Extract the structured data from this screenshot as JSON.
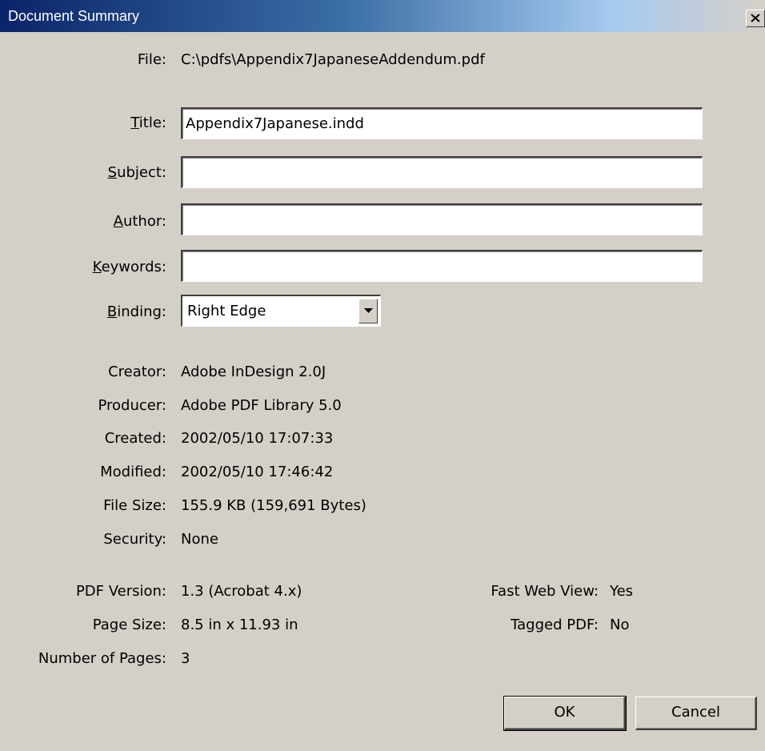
{
  "window": {
    "title": "Document Summary",
    "close_icon": "close-x-icon"
  },
  "file": {
    "label": "File:",
    "value": "C:\\pdfs\\Appendix7JapaneseAddendum.pdf"
  },
  "fields": {
    "title": {
      "label_accel": "T",
      "label_rest": "itle:",
      "value": "Appendix7Japanese.indd"
    },
    "subject": {
      "label_accel": "S",
      "label_rest": "ubject:",
      "value": ""
    },
    "author": {
      "label_accel": "A",
      "label_rest": "uthor:",
      "value": ""
    },
    "keywords": {
      "label_accel": "K",
      "label_rest": "eywords:",
      "value": ""
    }
  },
  "binding": {
    "label_accel": "B",
    "label_rest": "inding:",
    "value": "Right Edge",
    "arrow_icon": "chevron-down-icon"
  },
  "info": {
    "creator": {
      "label": "Creator:",
      "value": "Adobe InDesign 2.0J"
    },
    "producer": {
      "label": "Producer:",
      "value": "Adobe PDF Library 5.0"
    },
    "created": {
      "label": "Created:",
      "value": "2002/05/10 17:07:33"
    },
    "modified": {
      "label": "Modified:",
      "value": "2002/05/10 17:46:42"
    },
    "file_size": {
      "label": "File Size:",
      "value": "155.9 KB (159,691 Bytes)"
    },
    "security": {
      "label": "Security:",
      "value": "None"
    }
  },
  "pdf": {
    "version": {
      "label": "PDF Version:",
      "value": "1.3 (Acrobat 4.x)"
    },
    "page_size": {
      "label": "Page Size:",
      "value": "8.5 in x 11.93 in"
    },
    "num_pages": {
      "label": "Number of Pages:",
      "value": "3"
    },
    "fast_web_view": {
      "label": "Fast Web View:",
      "value": "Yes"
    },
    "tagged_pdf": {
      "label": "Tagged PDF:",
      "value": "No"
    }
  },
  "buttons": {
    "ok": "OK",
    "cancel": "Cancel"
  }
}
